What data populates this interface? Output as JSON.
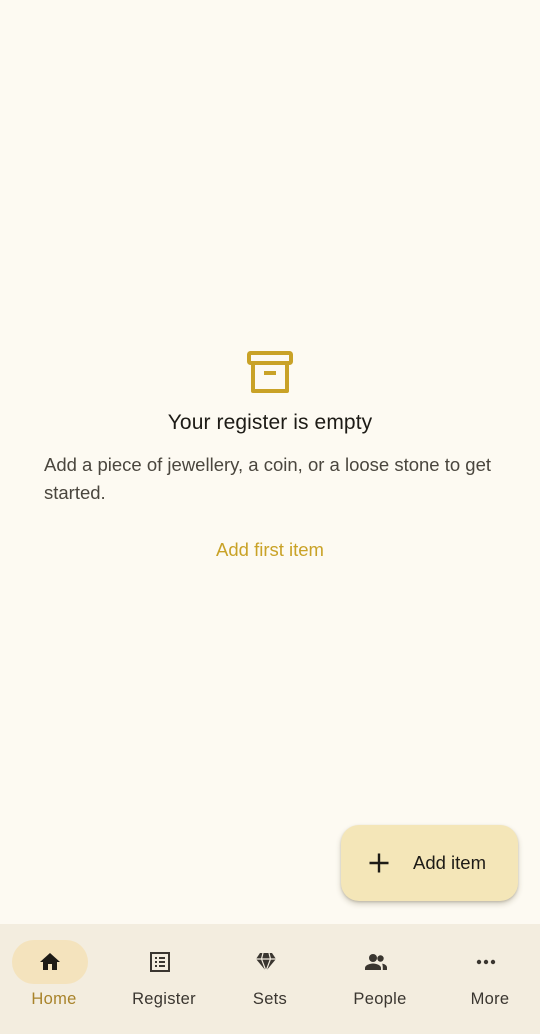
{
  "colors": {
    "background": "#fdfaf2",
    "accent": "#c9a227",
    "fab_background": "#f4e6b8",
    "nav_background": "#f3eddf",
    "nav_active_indicator": "#f4e3bd"
  },
  "empty_state": {
    "icon": "archive-box-icon",
    "title": "Your register is empty",
    "body": "Add a piece of jewellery, a coin, or a loose stone to get started.",
    "action_label": "Add first item"
  },
  "fab": {
    "icon": "plus-icon",
    "label": "Add item"
  },
  "bottom_nav": {
    "items": [
      {
        "label": "Home",
        "icon": "home-icon",
        "active": true
      },
      {
        "label": "Register",
        "icon": "list-icon",
        "active": false
      },
      {
        "label": "Sets",
        "icon": "gem-icon",
        "active": false
      },
      {
        "label": "People",
        "icon": "people-icon",
        "active": false
      },
      {
        "label": "More",
        "icon": "more-horiz-icon",
        "active": false
      }
    ]
  }
}
